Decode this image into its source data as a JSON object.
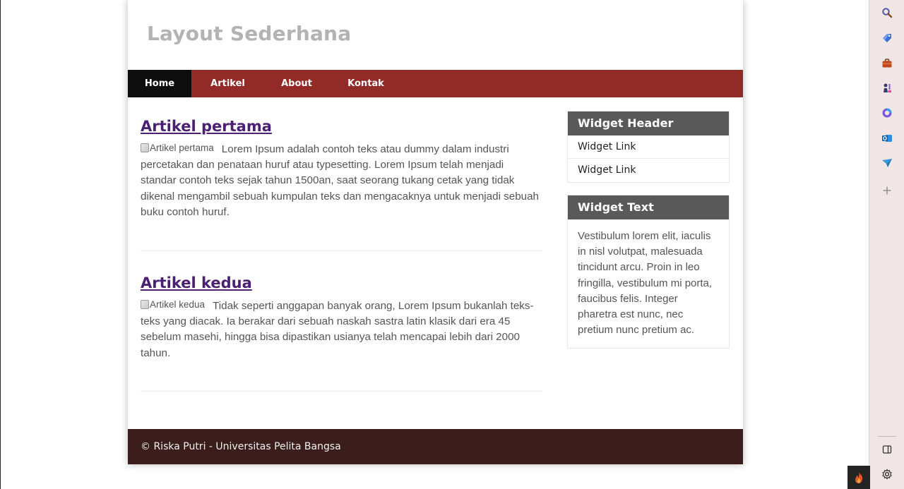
{
  "header": {
    "title": "Layout Sederhana"
  },
  "nav": {
    "items": [
      {
        "label": "Home",
        "active": true
      },
      {
        "label": "Artikel",
        "active": false
      },
      {
        "label": "About",
        "active": false
      },
      {
        "label": "Kontak",
        "active": false
      }
    ]
  },
  "articles": [
    {
      "title": "Artikel pertama",
      "image_alt": "Artikel pertama",
      "body": "Lorem Ipsum adalah contoh teks atau dummy dalam industri percetakan dan penataan huruf atau typesetting. Lorem Ipsum telah menjadi standar contoh teks sejak tahun 1500an, saat seorang tukang cetak yang tidak dikenal mengambil sebuah kumpulan teks dan mengacaknya untuk menjadi sebuah buku contoh huruf."
    },
    {
      "title": "Artikel kedua",
      "image_alt": "Artikel kedua",
      "body": "Tidak seperti anggapan banyak orang, Lorem Ipsum bukanlah teks-teks yang diacak. Ia berakar dari sebuah naskah sastra latin klasik dari era 45 sebelum masehi, hingga bisa dipastikan usianya telah mencapai lebih dari 2000 tahun."
    }
  ],
  "sidebar": {
    "widget_links": {
      "header": "Widget Header",
      "links": [
        "Widget Link",
        "Widget Link"
      ]
    },
    "widget_text": {
      "header": "Widget Text",
      "text": "Vestibulum lorem elit, iaculis in nisl volutpat, malesuada tincidunt arcu. Proin in leo fringilla, vestibulum mi porta, faucibus felis. Integer pharetra est nunc, nec pretium nunc pretium ac."
    }
  },
  "footer": {
    "text": "© Riska Putri - Universitas Pelita Bangsa"
  },
  "browser_sidebar": {
    "icons": [
      "search-icon",
      "tag-icon",
      "briefcase-icon",
      "chess-icon",
      "copilot-icon",
      "outlook-icon",
      "send-icon",
      "add-icon"
    ],
    "bottom_icons": [
      "split-screen-icon",
      "settings-icon"
    ]
  },
  "colors": {
    "nav_bg": "#922a27",
    "nav_active_bg": "#0d0d0d",
    "footer_bg": "#3b1d1b",
    "widget_header_bg": "#595959",
    "title_color": "#b3b3b3",
    "link_color": "#4b1f72"
  }
}
